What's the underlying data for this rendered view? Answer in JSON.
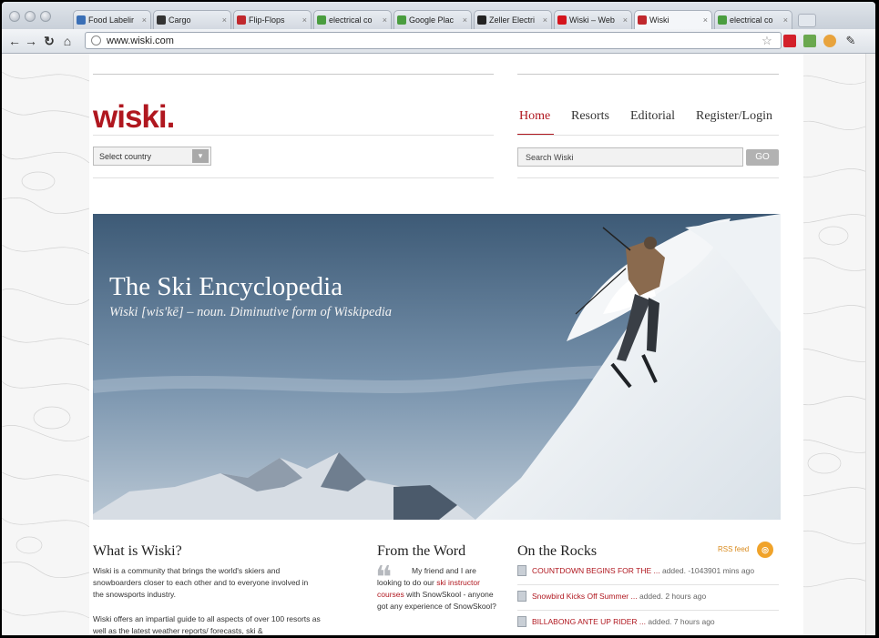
{
  "browser": {
    "tabs": [
      {
        "label": "Food Labelir",
        "favicon_color": "#3a6fb6",
        "active": false
      },
      {
        "label": "Cargo",
        "favicon_color": "#333333",
        "active": false
      },
      {
        "label": "Flip-Flops",
        "favicon_color": "#c0282d",
        "active": false
      },
      {
        "label": "electrical co",
        "favicon_color": "#4a9d3f",
        "active": false
      },
      {
        "label": "Google Plac",
        "favicon_color": "#4a9d3f",
        "active": false
      },
      {
        "label": "Zeller Electri",
        "favicon_color": "#222222",
        "active": false
      },
      {
        "label": "Wiski – Web",
        "favicon_color": "#d4141c",
        "active": false
      },
      {
        "label": "Wiski",
        "favicon_color": "#c0282d",
        "active": true
      },
      {
        "label": "electrical co",
        "favicon_color": "#4a9d3f",
        "active": false
      }
    ],
    "address": "www.wiski.com"
  },
  "site": {
    "logo": "wiski",
    "country_select": "Select country",
    "nav": [
      "Home",
      "Resorts",
      "Editorial",
      "Register/Login"
    ],
    "search_placeholder": "Search Wiski",
    "go_label": "GO",
    "brand_color": "#b0171f"
  },
  "hero": {
    "title": "The Ski Encyclopedia",
    "subtitle": "Wiski [wis'kē] – noun. Diminutive form of Wiskipedia"
  },
  "about": {
    "heading": "What is Wiski?",
    "p1": "Wiski is a community that brings the world's skiers and snowboarders closer to each other and to everyone involved in the snowsports industry.",
    "p2": "Wiski offers an impartial guide to all aspects of over 100 resorts as well as the latest weather reports/ forecasts, ski &"
  },
  "word": {
    "heading": "From the Word",
    "q1": "My friend and I are looking to do our ",
    "q_link": "ski instructor courses",
    "q2": " with SnowSkool - anyone got any experience of SnowSkool?"
  },
  "rocks": {
    "heading": "On the Rocks",
    "rss": "RSS feed",
    "items": [
      {
        "title": "COUNTDOWN BEGINS FOR THE ...",
        "meta": "added. -1043901 mins ago"
      },
      {
        "title": "Snowbird Kicks Off Summer ...",
        "meta": "added. 2 hours ago"
      },
      {
        "title": "BILLABONG ANTE UP RIDER ...",
        "meta": "added. 7 hours ago"
      }
    ]
  }
}
